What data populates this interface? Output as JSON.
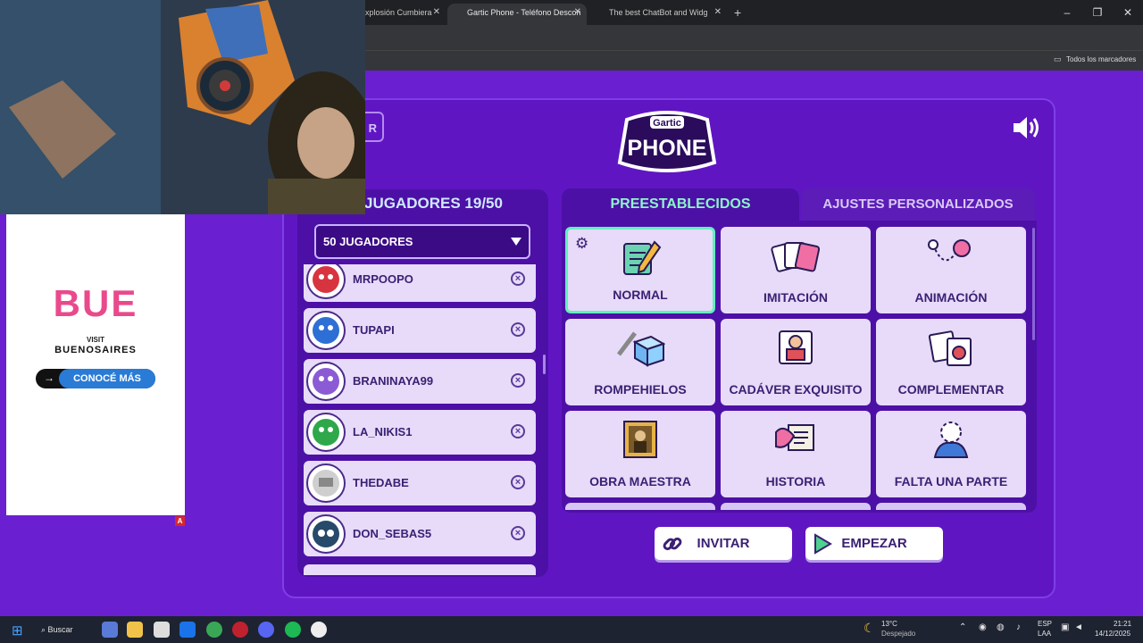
{
  "browser": {
    "tabs": [
      {
        "title": "xplosión Cumbiera",
        "close": "✕"
      },
      {
        "title": "Gartic Phone - Teléfono Descon",
        "close": "✕"
      },
      {
        "title": "The best ChatBot and Widg",
        "close": "✕"
      }
    ],
    "new_tab": "+",
    "bookmarks_label": "Todos los marcadores",
    "window_controls": [
      "–",
      "❐",
      "✕"
    ]
  },
  "game": {
    "back_label": "R",
    "logo_top": "Gartic",
    "logo_bottom": "PHONE",
    "players_title": "JUGADORES 19/50",
    "players_select": "50 JUGADORES",
    "players": [
      {
        "name": "MRPOOPO",
        "avatar_color": "#d8343f"
      },
      {
        "name": "TUPAPI",
        "avatar_color": "#2e6fd6"
      },
      {
        "name": "BRANINAYA99",
        "avatar_color": "#8b5bd6"
      },
      {
        "name": "LA_NIKIS1",
        "avatar_color": "#2ea84a"
      },
      {
        "name": "THEDABE",
        "avatar_color": "#dcdcdc"
      },
      {
        "name": "DON_SEBAS5",
        "avatar_color": "#274a6b"
      }
    ],
    "tab_presets": "PREESTABLECIDOS",
    "tab_custom": "AJUSTES PERSONALIZADOS",
    "presets": [
      {
        "label": "NORMAL",
        "icon": "pencil-notepad-icon",
        "selected": true
      },
      {
        "label": "IMITACIÓN",
        "icon": "cards-icon",
        "selected": false
      },
      {
        "label": "ANIMACIÓN",
        "icon": "animation-icon",
        "selected": false
      },
      {
        "label": "ROMPEHIELOS",
        "icon": "ice-cube-icon",
        "selected": false
      },
      {
        "label": "CADÁVER EXQUISITO",
        "icon": "exquisite-corpse-icon",
        "selected": false
      },
      {
        "label": "COMPLEMENTAR",
        "icon": "puzzle-icon",
        "selected": false
      },
      {
        "label": "OBRA MAESTRA",
        "icon": "painting-icon",
        "selected": false
      },
      {
        "label": "HISTORIA",
        "icon": "scroll-icon",
        "selected": false
      },
      {
        "label": "FALTA UNA PARTE",
        "icon": "missing-part-icon",
        "selected": false
      }
    ],
    "invite_label": "INVITAR",
    "start_label": "EMPEZAR",
    "accent": "#63efc1"
  },
  "ad": {
    "brand": "BUE",
    "line1": "VISIT",
    "line2": "BUENOSAIRES",
    "cta": "CONOCÉ MÁS",
    "badge": "A"
  },
  "taskbar": {
    "search": "Buscar",
    "weather_temp": "13°C",
    "weather_desc": "Despejado",
    "lang1": "ESP",
    "lang2": "LAA",
    "time": "21:21",
    "date": "14/12/2025"
  }
}
